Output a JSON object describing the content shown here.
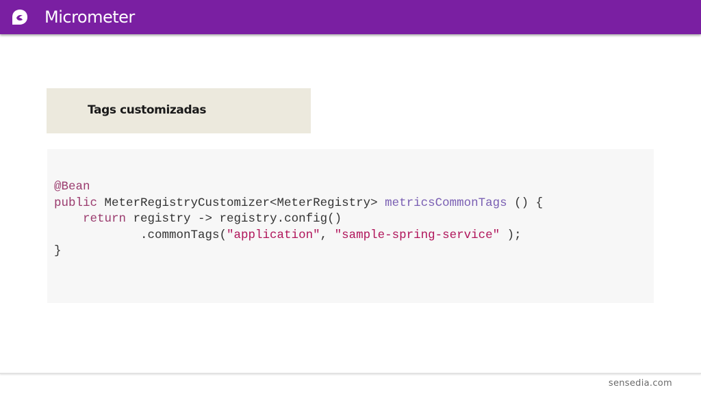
{
  "header": {
    "title": "Micrometer",
    "background_color": "#7a1fa2",
    "logo_icon": "sensedia-logo-icon"
  },
  "section": {
    "label": "Tags customizadas",
    "background_color": "#ece9dd"
  },
  "code": {
    "annotation": "@Bean",
    "line2_kw": "public",
    "line2_type": " MeterRegistryCustomizer<MeterRegistry> ",
    "line2_fn": "metricsCommonTags",
    "line2_end": " () {",
    "line3_indent": "    ",
    "line3_kw": "return",
    "line3_rest": " registry -> registry.config()",
    "line4_prefix": "            .commonTags(",
    "line4_str1": "\"application\"",
    "line4_sep": ", ",
    "line4_str2": "\"sample-spring-service\"",
    "line4_end": " );",
    "line5": "}"
  },
  "footer": {
    "brand": "sensedia.com"
  }
}
